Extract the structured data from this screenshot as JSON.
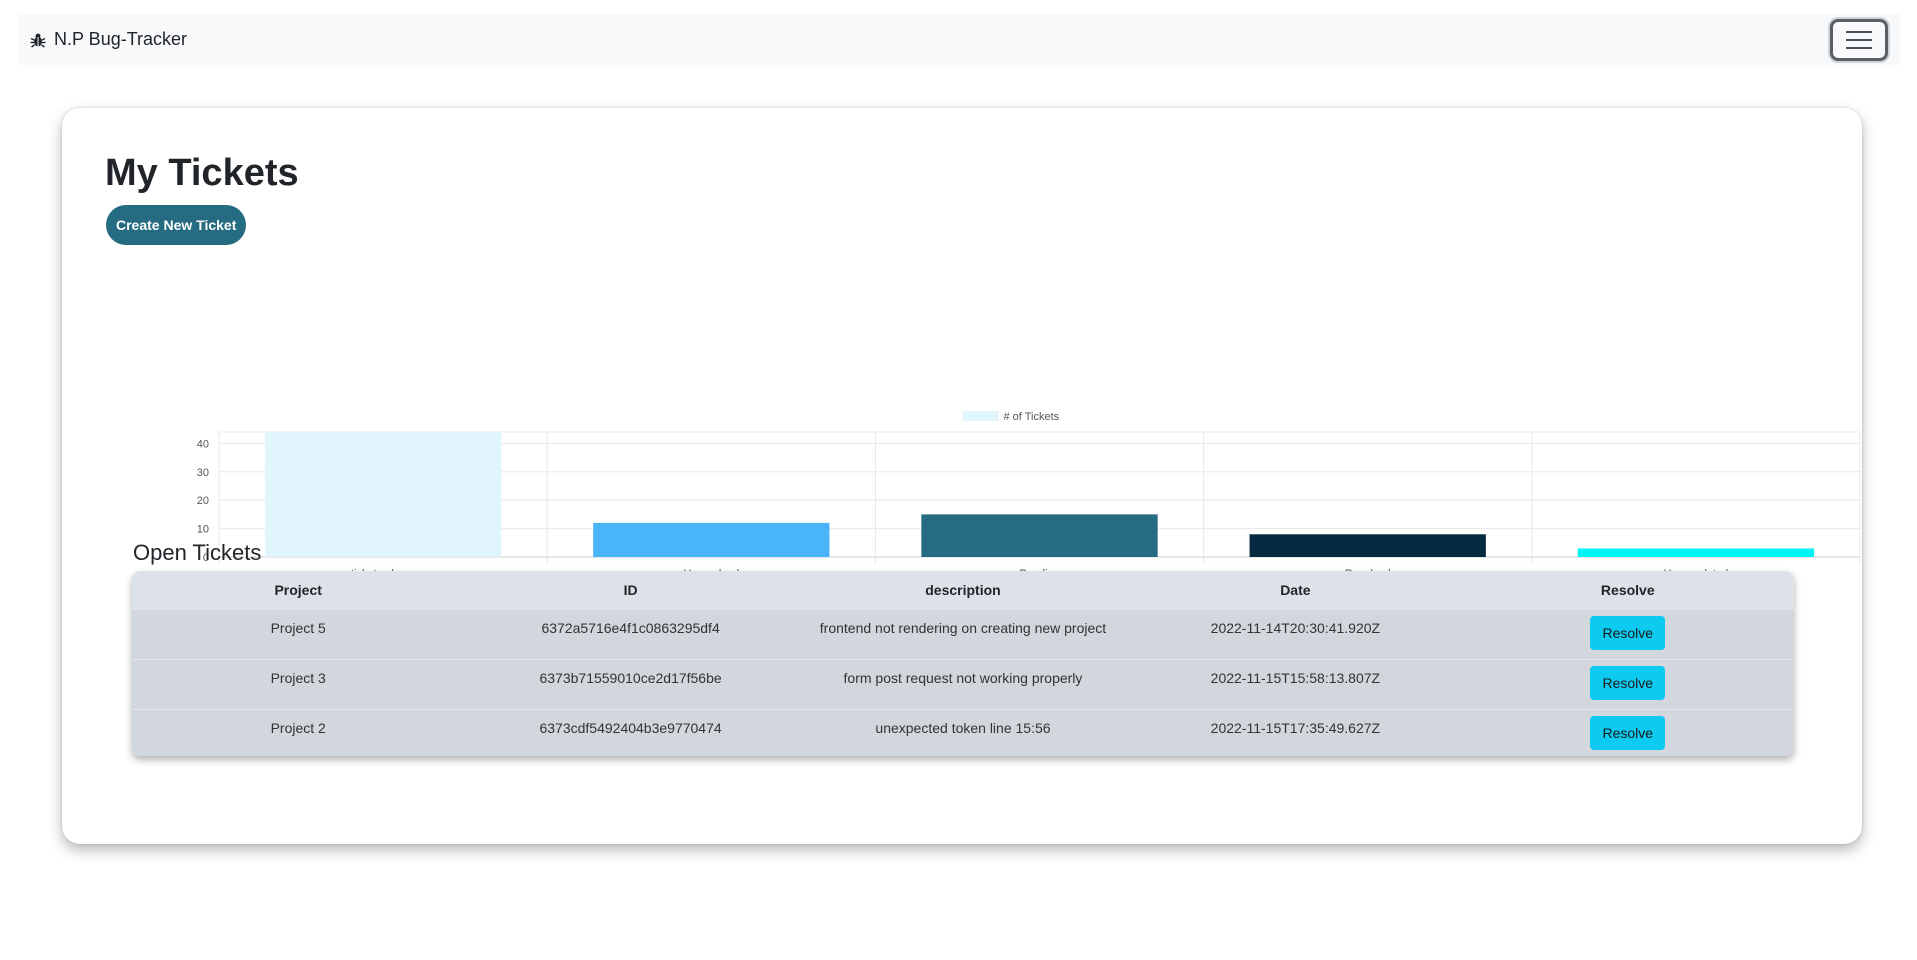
{
  "navbar": {
    "brand": "N.P Bug-Tracker",
    "brand_icon": "bug-icon",
    "toggle_icon": "hamburger-icon"
  },
  "page": {
    "title": "My Tickets",
    "create_button": "Create New Ticket"
  },
  "chart_data": {
    "type": "bar",
    "legend": "# of Tickets",
    "legend_placement": "top-center",
    "categories": [
      "ticket volume",
      "Unresolved",
      "Pending",
      "Resolved",
      "Uncompleted"
    ],
    "values": [
      44,
      12,
      15,
      8,
      3
    ],
    "colors": [
      "#e0f5fc",
      "#4ab4f8",
      "#256b82",
      "#062a40",
      "#00f5f5"
    ],
    "ylim": [
      0,
      44
    ],
    "yticks": [
      0,
      10,
      20,
      30,
      40
    ],
    "grid": true
  },
  "open_tickets": {
    "title": "Open Tickets",
    "headers": [
      "Project",
      "ID",
      "description",
      "Date",
      "Resolve"
    ],
    "rows": [
      {
        "project": "Project 5",
        "id": "6372a5716e4f1c0863295df4",
        "description": "frontend not rendering on creating new project",
        "date": "2022-11-14T20:30:41.920Z",
        "action": "Resolve"
      },
      {
        "project": "Project 3",
        "id": "6373b71559010ce2d17f56be",
        "description": "form post request not working properly",
        "date": "2022-11-15T15:58:13.807Z",
        "action": "Resolve"
      },
      {
        "project": "Project 2",
        "id": "6373cdf5492404b3e9770474",
        "description": "unexpected token line 15:56",
        "date": "2022-11-15T17:35:49.627Z",
        "action": "Resolve"
      }
    ]
  },
  "colors": {
    "primary": "#256b82",
    "resolve_button": "#0dcaf0",
    "navbar_bg": "#f8f9fa"
  }
}
